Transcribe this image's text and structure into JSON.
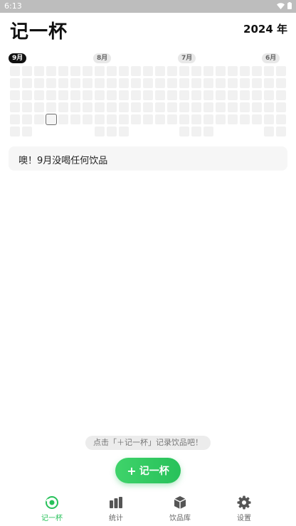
{
  "status_bar": {
    "time": "6:13"
  },
  "header": {
    "title": "记一杯",
    "year": "2024 年"
  },
  "heatmap": {
    "months": [
      {
        "label": "9月",
        "active": true
      },
      {
        "label": "8月",
        "active": false
      },
      {
        "label": "7月",
        "active": false
      },
      {
        "label": "6月",
        "active": false
      }
    ]
  },
  "empty_message": "噢！9月没喝任何饮品",
  "hint": "点击「＋记一杯」记录饮品吧！",
  "fab": {
    "label": "记一杯",
    "icon": "plus"
  },
  "tabs": [
    {
      "label": "记一杯",
      "icon": "cup-icon",
      "active": true
    },
    {
      "label": "统计",
      "icon": "bar-chart-icon",
      "active": false
    },
    {
      "label": "饮品库",
      "icon": "box-icon",
      "active": false
    },
    {
      "label": "设置",
      "icon": "gear-icon",
      "active": false
    }
  ],
  "colors": {
    "accent": "#27c15a",
    "cell": "#f1f1f1"
  }
}
